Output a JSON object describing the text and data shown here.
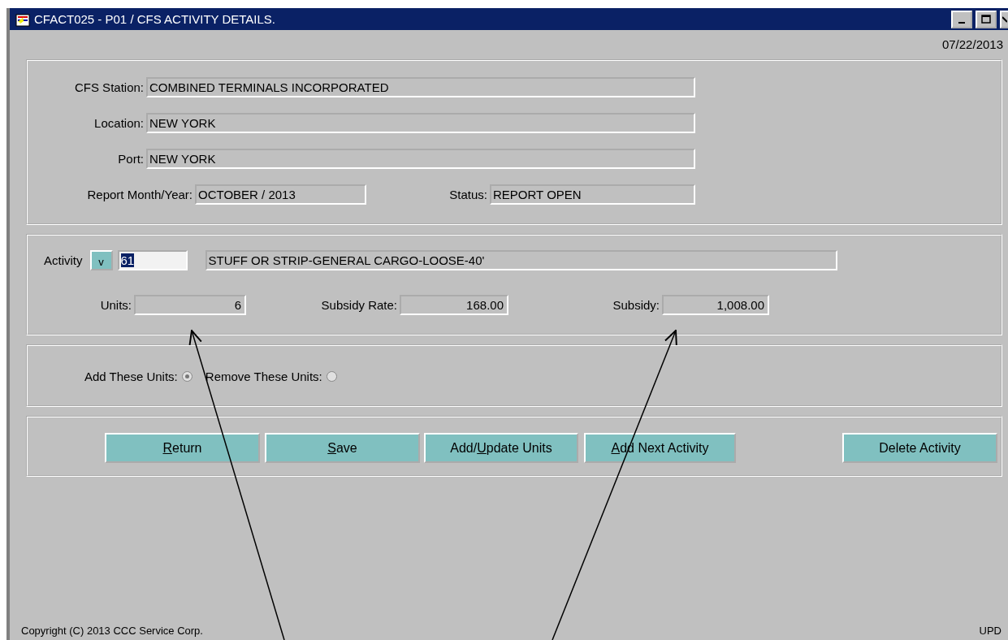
{
  "window": {
    "title": "CFACT025 - P01 / CFS ACTIVITY DETAILS."
  },
  "date": "07/22/2013",
  "header": {
    "fields": [
      {
        "label": "CFS Station:",
        "value": "COMBINED TERMINALS INCORPORATED"
      },
      {
        "label": "Location:",
        "value": "NEW YORK"
      },
      {
        "label": "Port:",
        "value": "NEW YORK"
      }
    ],
    "report_month": {
      "label": "Report Month/Year:",
      "value": "OCTOBER / 2013"
    },
    "status": {
      "label": "Status:",
      "value": "REPORT OPEN"
    }
  },
  "activity": {
    "label": "Activity",
    "list_button": "v",
    "code": "61",
    "description": "STUFF OR STRIP-GENERAL CARGO-LOOSE-40'",
    "amounts": [
      {
        "label": "Units:",
        "value": "6"
      },
      {
        "label": "Subsidy Rate:",
        "value": "168.00"
      },
      {
        "label": "Subsidy:",
        "value": "1,008.00"
      }
    ]
  },
  "unit_action": [
    {
      "label": "Add These Units:",
      "selected": true
    },
    {
      "label": "Remove These Units:",
      "selected": false
    }
  ],
  "buttons": [
    {
      "key": "R",
      "after": "eturn"
    },
    {
      "key": "S",
      "after": "ave"
    },
    {
      "before": "Add/",
      "key": "U",
      "after": "pdate Units"
    },
    {
      "key": "A",
      "after": "dd Next Activity"
    },
    {
      "before": "Delete Activity"
    }
  ],
  "footer": {
    "copyright": "Copyright (C) 2013 CCC Service Corp.",
    "mode": "UPD"
  }
}
